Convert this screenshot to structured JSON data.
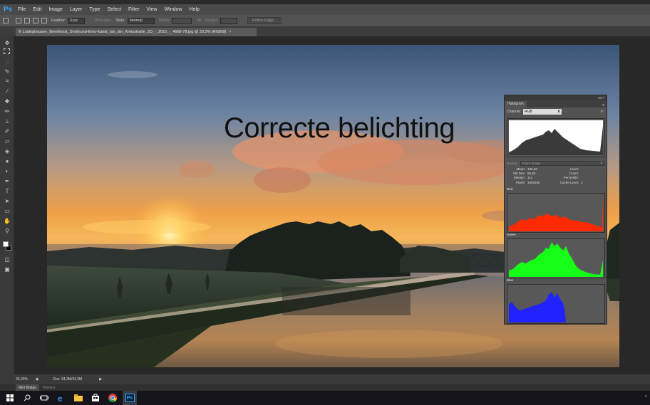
{
  "app": {
    "logo": "Ps",
    "menu": [
      "File",
      "Edit",
      "Image",
      "Layer",
      "Type",
      "Select",
      "Filter",
      "View",
      "Window",
      "Help"
    ]
  },
  "options": {
    "feather_label": "Feather:",
    "feather_value": "0 px",
    "antialias_label": "Anti-alias",
    "style_label": "Style:",
    "style_value": "Normal",
    "width_label": "Width:",
    "height_label": "Height:",
    "refine_label": "Refine Edge..."
  },
  "document": {
    "tab_title": "© Lüdinghausen_Bremhorst_Dortmund-Ems-Kanal_(an_der_Kreisstraße_ZD_-_2015_-_4668-78.jpg @ 33,3% (RGB/8)",
    "tab_close": "×",
    "overlay_caption": "Correcte belichting"
  },
  "histogram": {
    "tab_label": "Histogram",
    "collapse_label": "◂◂  ×",
    "channel_label": "Channel:",
    "channel_value": "RGB",
    "source_label": "Source:",
    "source_value": "Entire Image",
    "stats_left": [
      {
        "label": "Mean:",
        "value": "105,36"
      },
      {
        "label": "Std Dev:",
        "value": "55,69"
      },
      {
        "label": "Median:",
        "value": "111"
      },
      {
        "label": "Pixels:",
        "value": "1092936"
      }
    ],
    "stats_right": [
      {
        "label": "Level:",
        "value": ""
      },
      {
        "label": "Count:",
        "value": ""
      },
      {
        "label": "Percentile:",
        "value": ""
      },
      {
        "label": "Cache Level:",
        "value": "1"
      }
    ],
    "channels": [
      {
        "name": "Red",
        "color": "#ff2a00"
      },
      {
        "name": "Green",
        "color": "#16ff16"
      },
      {
        "name": "Blue",
        "color": "#2222ff"
      }
    ]
  },
  "status": {
    "zoom": "33,33%",
    "doc_size": "Doc: 34,3M/34,3M",
    "arrow": "▶"
  },
  "bottom_tabs": {
    "mini_bridge": "Mini Bridge",
    "timeline": "Timeline"
  },
  "taskbar": {
    "icons": [
      "windows-icon",
      "search-icon",
      "task-view-icon",
      "edge-icon",
      "file-explorer-icon",
      "store-icon",
      "chrome-icon",
      "photoshop-icon"
    ],
    "ps_label": "Ps"
  }
}
